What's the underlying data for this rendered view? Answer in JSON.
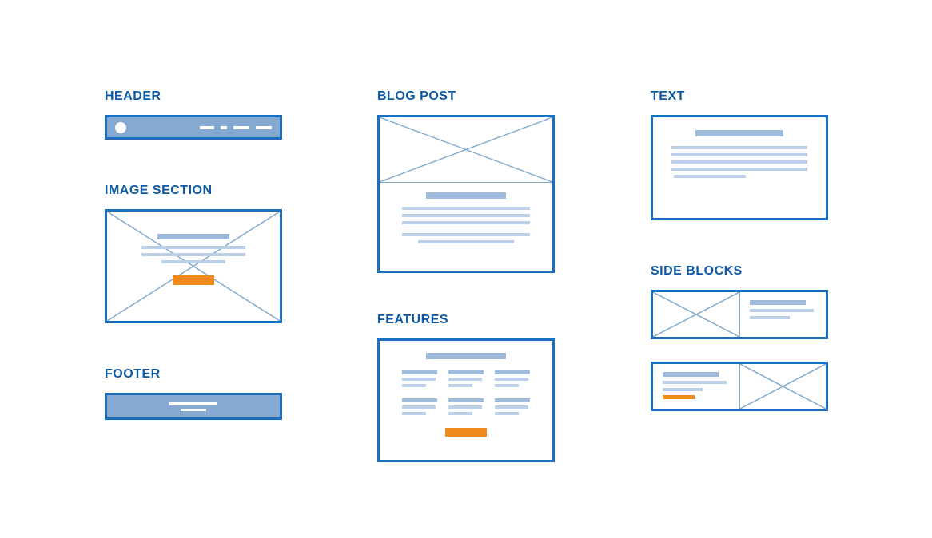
{
  "colors": {
    "primary": "#1a6fbf",
    "label": "#0e5aa7",
    "fill": "#85a9d1",
    "bar_dark": "#9fbbdb",
    "bar_light": "#bcd1e8",
    "accent": "#f08a1d",
    "white": "#ffffff"
  },
  "labels": {
    "header": "HEADER",
    "image_section": "IMAGE SECTION",
    "footer": "FOOTER",
    "blog_post": "BLOG POST",
    "features": "FEATURES",
    "text": "TEXT",
    "side_blocks": "SIDE BLOCKS"
  },
  "components": {
    "header": {
      "has_circle": true,
      "segments": 4
    },
    "image_section": {
      "placeholder_cross": true,
      "title_bar": true,
      "text_lines": 3,
      "cta_button": true
    },
    "footer": {
      "lines": 2
    },
    "blog_post": {
      "image_placeholder_cross": true,
      "title_bar": true,
      "body_lines": 5
    },
    "features": {
      "title_bar": true,
      "columns": 3,
      "cta_button": true
    },
    "text": {
      "title_bar": true,
      "body_lines": 5
    },
    "side_blocks": [
      {
        "image_side": "left",
        "text_side": "right",
        "accent": false
      },
      {
        "image_side": "right",
        "text_side": "left",
        "accent": true
      }
    ]
  }
}
